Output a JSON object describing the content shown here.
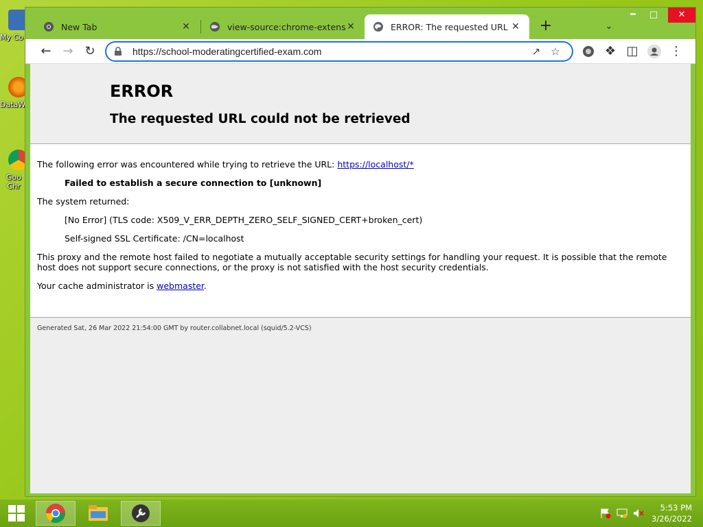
{
  "desktop": {
    "icons": [
      {
        "label": "My Co",
        "icon": "computer-icon"
      },
      {
        "label": "DataW",
        "icon": "datawrapper-icon"
      },
      {
        "label": "Goo Chr",
        "icon": "chrome-icon"
      }
    ]
  },
  "browser": {
    "tabs": [
      {
        "title": "New Tab",
        "icon": "chrome-icon",
        "active": false
      },
      {
        "title": "view-source:chrome-extension://",
        "icon": "extension-globe-icon",
        "active": false
      },
      {
        "title": "ERROR: The requested URL could",
        "icon": "globe-icon",
        "active": true
      }
    ],
    "address": "https://school-moderatingcertified-exam.com",
    "accent": "#1a73e8"
  },
  "page": {
    "heading": "ERROR",
    "subheading": "The requested URL could not be retrieved",
    "intro": "The following error was encountered while trying to retrieve the URL:",
    "url_link": "https://localhost/*",
    "failure": "Failed to establish a secure connection to [unknown]",
    "system_returned": "The system returned:",
    "tls_error": "[No Error] (TLS code: X509_V_ERR_DEPTH_ZERO_SELF_SIGNED_CERT+broken_cert)",
    "cert_info": "Self-signed SSL Certificate: /CN=localhost",
    "explanation": "This proxy and the remote host failed to negotiate a mutually acceptable security settings for handling your request. It is possible that the remote host does not support secure connections, or the proxy is not satisfied with the host security credentials.",
    "cache_admin_prefix": "Your cache administrator is",
    "cache_admin_link": "webmaster",
    "cache_admin_suffix": ".",
    "footer": "Generated Sat, 26 Mar 2022 21:54:00 GMT by router.collabnet.local (squid/5.2-VCS)"
  },
  "taskbar": {
    "time": "5:53 PM",
    "date": "3/26/2022"
  }
}
